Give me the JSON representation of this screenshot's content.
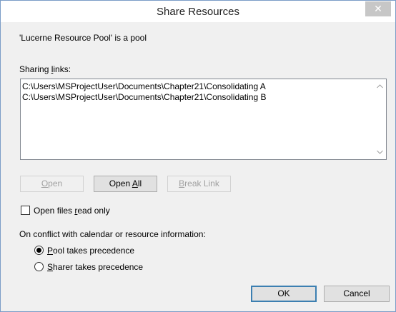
{
  "window": {
    "title": "Share Resources",
    "close_glyph": "✕"
  },
  "pool_status": "'Lucerne Resource Pool' is a pool",
  "sharing_links": {
    "label_pre": "Sharing ",
    "label_u": "l",
    "label_post": "inks:",
    "items": [
      "C:\\Users\\MSProjectUser\\Documents\\Chapter21\\Consolidating A",
      "C:\\Users\\MSProjectUser\\Documents\\Chapter21\\Consolidating B"
    ],
    "scroll_up_icon": "chevron-up-icon",
    "scroll_down_icon": "chevron-down-icon"
  },
  "buttons": {
    "open": {
      "u": "O",
      "rest": "pen",
      "enabled": false
    },
    "open_all": {
      "pre": "Open ",
      "u": "A",
      "rest": "ll",
      "enabled": true
    },
    "break_link": {
      "u": "B",
      "rest": "reak Link",
      "enabled": false
    }
  },
  "read_only": {
    "checked": false,
    "pre": "Open files ",
    "u": "r",
    "post": "ead only"
  },
  "conflict": {
    "label": "On conflict with calendar or resource information:",
    "options": [
      {
        "u": "P",
        "rest": "ool takes precedence",
        "selected": true
      },
      {
        "u": "S",
        "rest": "harer takes precedence",
        "selected": false
      }
    ]
  },
  "footer": {
    "ok": "OK",
    "cancel": "Cancel"
  }
}
